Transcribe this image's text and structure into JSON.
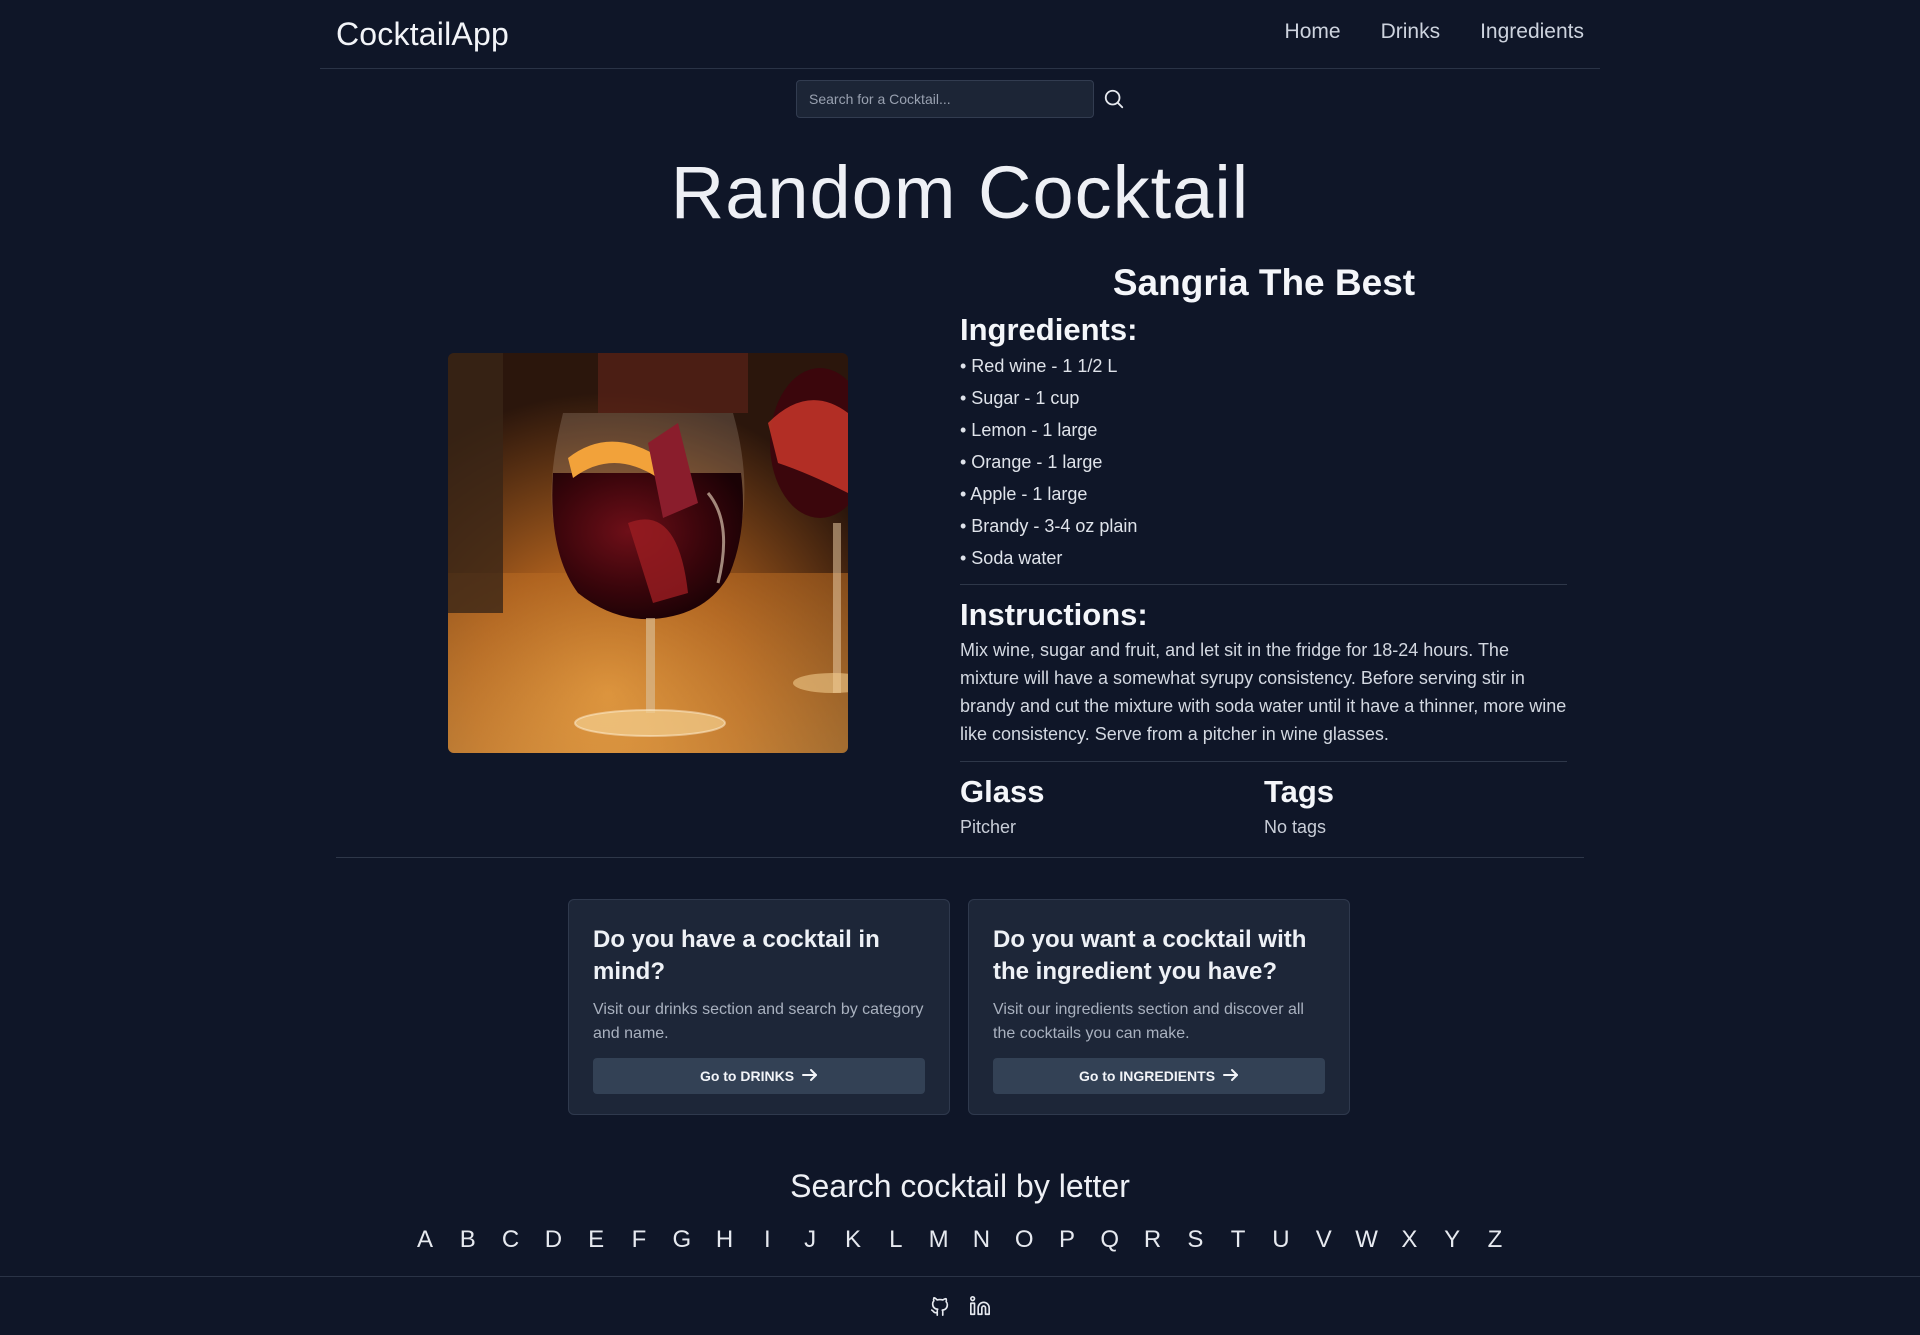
{
  "nav": {
    "brand": "CocktailApp",
    "links": [
      "Home",
      "Drinks",
      "Ingredients"
    ]
  },
  "search": {
    "placeholder": "Search for a Cocktail..."
  },
  "page_title": "Random Cocktail",
  "drink": {
    "name": "Sangria The Best",
    "ingredients_heading": "Ingredients:",
    "ingredients": [
      "• Red wine - 1 1/2 L",
      "• Sugar - 1 cup",
      "• Lemon - 1 large",
      "• Orange - 1 large",
      "• Apple - 1 large",
      "• Brandy - 3-4 oz plain",
      "• Soda water"
    ],
    "instructions_heading": "Instructions:",
    "instructions": "Mix wine, sugar and fruit, and let sit in the fridge for 18-24 hours. The mixture will have a somewhat syrupy consistency. Before serving stir in brandy and cut the mixture with soda water until it have a thinner, more wine like consistency. Serve from a pitcher in wine glasses.",
    "glass_label": "Glass",
    "glass": "Pitcher",
    "tags_label": "Tags",
    "tags": "No tags"
  },
  "cards": [
    {
      "title": "Do you have a cocktail in mind?",
      "text": "Visit our drinks section and search by category and name.",
      "button": "Go to DRINKS"
    },
    {
      "title": "Do you want a cocktail with the ingredient you have?",
      "text": "Visit our ingredients section and discover all the cocktails you can make.",
      "button": "Go to INGREDIENTS"
    }
  ],
  "letters_title": "Search cocktail by letter",
  "letters": [
    "A",
    "B",
    "C",
    "D",
    "E",
    "F",
    "G",
    "H",
    "I",
    "J",
    "K",
    "L",
    "M",
    "N",
    "O",
    "P",
    "Q",
    "R",
    "S",
    "T",
    "U",
    "V",
    "W",
    "X",
    "Y",
    "Z"
  ],
  "footer": {
    "icons": [
      "github-icon",
      "linkedin-icon"
    ]
  },
  "colors": {
    "background": "#0f1628",
    "card": "#1d2638",
    "button": "#334155"
  }
}
